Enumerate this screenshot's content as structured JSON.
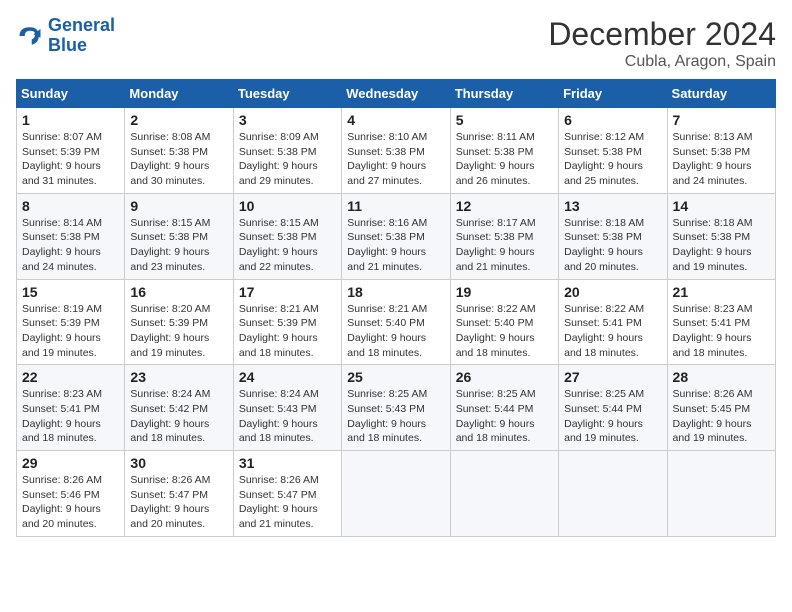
{
  "logo": {
    "line1": "General",
    "line2": "Blue"
  },
  "title": "December 2024",
  "subtitle": "Cubla, Aragon, Spain",
  "days_header": [
    "Sunday",
    "Monday",
    "Tuesday",
    "Wednesday",
    "Thursday",
    "Friday",
    "Saturday"
  ],
  "weeks": [
    [
      {
        "day": "1",
        "sunrise": "8:07 AM",
        "sunset": "5:39 PM",
        "daylight": "9 hours and 31 minutes."
      },
      {
        "day": "2",
        "sunrise": "8:08 AM",
        "sunset": "5:38 PM",
        "daylight": "9 hours and 30 minutes."
      },
      {
        "day": "3",
        "sunrise": "8:09 AM",
        "sunset": "5:38 PM",
        "daylight": "9 hours and 29 minutes."
      },
      {
        "day": "4",
        "sunrise": "8:10 AM",
        "sunset": "5:38 PM",
        "daylight": "9 hours and 27 minutes."
      },
      {
        "day": "5",
        "sunrise": "8:11 AM",
        "sunset": "5:38 PM",
        "daylight": "9 hours and 26 minutes."
      },
      {
        "day": "6",
        "sunrise": "8:12 AM",
        "sunset": "5:38 PM",
        "daylight": "9 hours and 25 minutes."
      },
      {
        "day": "7",
        "sunrise": "8:13 AM",
        "sunset": "5:38 PM",
        "daylight": "9 hours and 24 minutes."
      }
    ],
    [
      {
        "day": "8",
        "sunrise": "8:14 AM",
        "sunset": "5:38 PM",
        "daylight": "9 hours and 24 minutes."
      },
      {
        "day": "9",
        "sunrise": "8:15 AM",
        "sunset": "5:38 PM",
        "daylight": "9 hours and 23 minutes."
      },
      {
        "day": "10",
        "sunrise": "8:15 AM",
        "sunset": "5:38 PM",
        "daylight": "9 hours and 22 minutes."
      },
      {
        "day": "11",
        "sunrise": "8:16 AM",
        "sunset": "5:38 PM",
        "daylight": "9 hours and 21 minutes."
      },
      {
        "day": "12",
        "sunrise": "8:17 AM",
        "sunset": "5:38 PM",
        "daylight": "9 hours and 21 minutes."
      },
      {
        "day": "13",
        "sunrise": "8:18 AM",
        "sunset": "5:38 PM",
        "daylight": "9 hours and 20 minutes."
      },
      {
        "day": "14",
        "sunrise": "8:18 AM",
        "sunset": "5:38 PM",
        "daylight": "9 hours and 19 minutes."
      }
    ],
    [
      {
        "day": "15",
        "sunrise": "8:19 AM",
        "sunset": "5:39 PM",
        "daylight": "9 hours and 19 minutes."
      },
      {
        "day": "16",
        "sunrise": "8:20 AM",
        "sunset": "5:39 PM",
        "daylight": "9 hours and 19 minutes."
      },
      {
        "day": "17",
        "sunrise": "8:21 AM",
        "sunset": "5:39 PM",
        "daylight": "9 hours and 18 minutes."
      },
      {
        "day": "18",
        "sunrise": "8:21 AM",
        "sunset": "5:40 PM",
        "daylight": "9 hours and 18 minutes."
      },
      {
        "day": "19",
        "sunrise": "8:22 AM",
        "sunset": "5:40 PM",
        "daylight": "9 hours and 18 minutes."
      },
      {
        "day": "20",
        "sunrise": "8:22 AM",
        "sunset": "5:41 PM",
        "daylight": "9 hours and 18 minutes."
      },
      {
        "day": "21",
        "sunrise": "8:23 AM",
        "sunset": "5:41 PM",
        "daylight": "9 hours and 18 minutes."
      }
    ],
    [
      {
        "day": "22",
        "sunrise": "8:23 AM",
        "sunset": "5:41 PM",
        "daylight": "9 hours and 18 minutes."
      },
      {
        "day": "23",
        "sunrise": "8:24 AM",
        "sunset": "5:42 PM",
        "daylight": "9 hours and 18 minutes."
      },
      {
        "day": "24",
        "sunrise": "8:24 AM",
        "sunset": "5:43 PM",
        "daylight": "9 hours and 18 minutes."
      },
      {
        "day": "25",
        "sunrise": "8:25 AM",
        "sunset": "5:43 PM",
        "daylight": "9 hours and 18 minutes."
      },
      {
        "day": "26",
        "sunrise": "8:25 AM",
        "sunset": "5:44 PM",
        "daylight": "9 hours and 18 minutes."
      },
      {
        "day": "27",
        "sunrise": "8:25 AM",
        "sunset": "5:44 PM",
        "daylight": "9 hours and 19 minutes."
      },
      {
        "day": "28",
        "sunrise": "8:26 AM",
        "sunset": "5:45 PM",
        "daylight": "9 hours and 19 minutes."
      }
    ],
    [
      {
        "day": "29",
        "sunrise": "8:26 AM",
        "sunset": "5:46 PM",
        "daylight": "9 hours and 20 minutes."
      },
      {
        "day": "30",
        "sunrise": "8:26 AM",
        "sunset": "5:47 PM",
        "daylight": "9 hours and 20 minutes."
      },
      {
        "day": "31",
        "sunrise": "8:26 AM",
        "sunset": "5:47 PM",
        "daylight": "9 hours and 21 minutes."
      },
      null,
      null,
      null,
      null
    ]
  ]
}
